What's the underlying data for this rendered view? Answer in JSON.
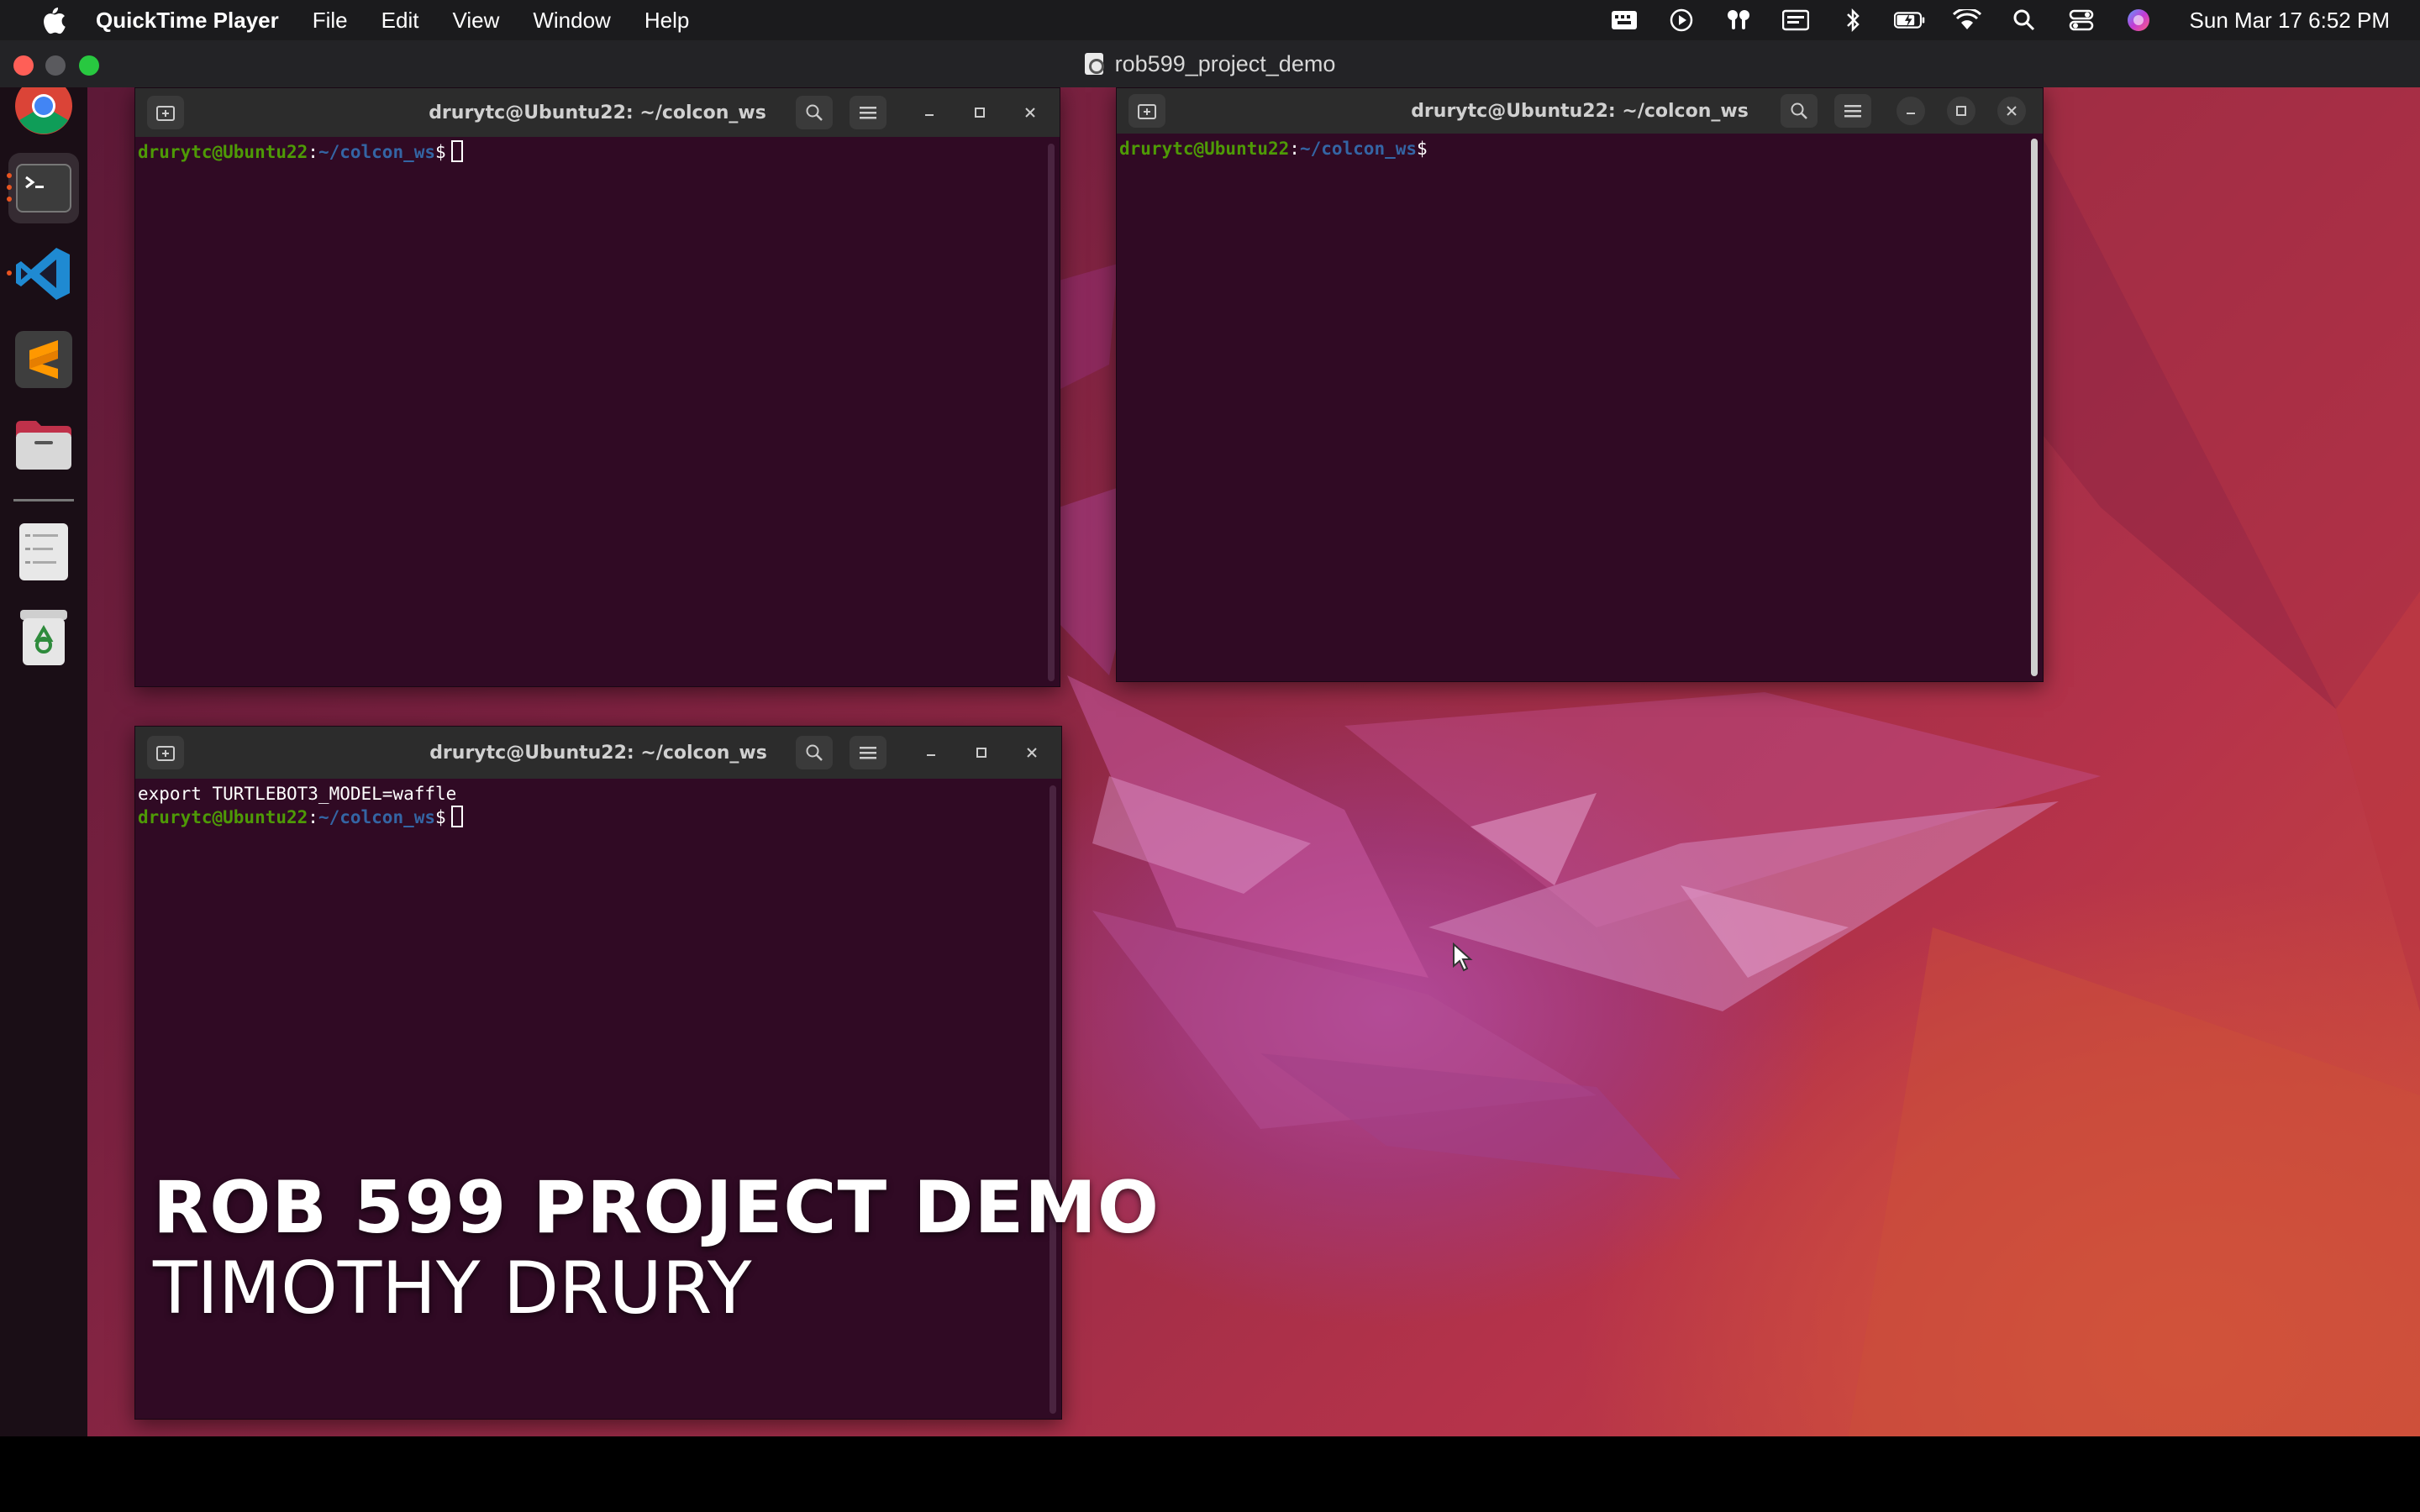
{
  "menubar": {
    "app_name": "QuickTime Player",
    "items": [
      "File",
      "Edit",
      "View",
      "Window",
      "Help"
    ],
    "status_icons": [
      "screen-recording-icon",
      "play-icon",
      "airpods-icon",
      "keyboard-input-icon",
      "bluetooth-icon",
      "battery-charging-icon",
      "wifi-icon",
      "spotlight-search-icon",
      "control-center-icon",
      "siri-icon"
    ],
    "clock": "Sun Mar 17  6:52 PM"
  },
  "quicktime": {
    "title": "rob599_project_demo"
  },
  "dock": {
    "apps": [
      "chrome-icon",
      "terminal-icon",
      "vscode-icon",
      "sublime-text-icon",
      "files-icon",
      "text-editor-icon",
      "trash-icon"
    ]
  },
  "terminals": [
    {
      "title": "drurytc@Ubuntu22: ~/colcon_ws",
      "lines": [],
      "prompt_user": "drurytc@Ubuntu22",
      "prompt_sep": ":",
      "prompt_path": "~/colcon_ws",
      "prompt_dollar": "$"
    },
    {
      "title": "drurytc@Ubuntu22: ~/colcon_ws",
      "lines": [],
      "prompt_user": "drurytc@Ubuntu22",
      "prompt_sep": ":",
      "prompt_path": "~/colcon_ws",
      "prompt_dollar": "$"
    },
    {
      "title": "drurytc@Ubuntu22: ~/colcon_ws",
      "lines": [
        "export TURTLEBOT3_MODEL=waffle"
      ],
      "prompt_user": "drurytc@Ubuntu22",
      "prompt_sep": ":",
      "prompt_path": "~/colcon_ws",
      "prompt_dollar": "$"
    }
  ],
  "caption": {
    "line1": "ROB 599 PROJECT DEMO",
    "line2": "TIMOTHY DRURY"
  },
  "colors": {
    "terminal_bg": "#300a24",
    "prompt_user": "#4e9a06",
    "prompt_path": "#3465a4",
    "ubuntu_orange": "#e95420"
  }
}
